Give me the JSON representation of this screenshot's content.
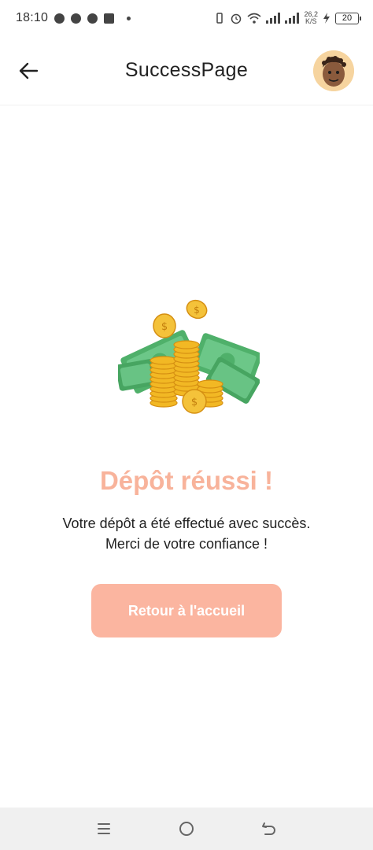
{
  "status_bar": {
    "time": "18:10",
    "net_speed": "26,2",
    "net_unit": "K/S",
    "battery": "20",
    "left_icons": [
      "snapchat-icon",
      "facebook-icon",
      "alarm-icon",
      "s-app-icon"
    ],
    "right_icons": [
      "vibrate-icon",
      "alarm-icon",
      "wifi-icon",
      "signal-icon",
      "signal-icon",
      "charging-icon",
      "battery-icon"
    ]
  },
  "app_bar": {
    "title": "SuccessPage",
    "back_icon": "arrow-left-icon",
    "avatar_icon": "user-avatar"
  },
  "content": {
    "title": "Dépôt réussi !",
    "message_line1": "Votre dépôt a été effectué avec succès.",
    "message_line2": "Merci de votre confiance !",
    "button_label": "Retour à l'accueil",
    "illustration": "money-coins-illustration"
  },
  "nav_bar": {
    "icons": [
      "recent-apps-icon",
      "home-icon",
      "back-icon"
    ]
  },
  "colors": {
    "accent": "#f8b39b",
    "button": "#fbb5a0",
    "nav_bg": "#f0f0f0"
  }
}
